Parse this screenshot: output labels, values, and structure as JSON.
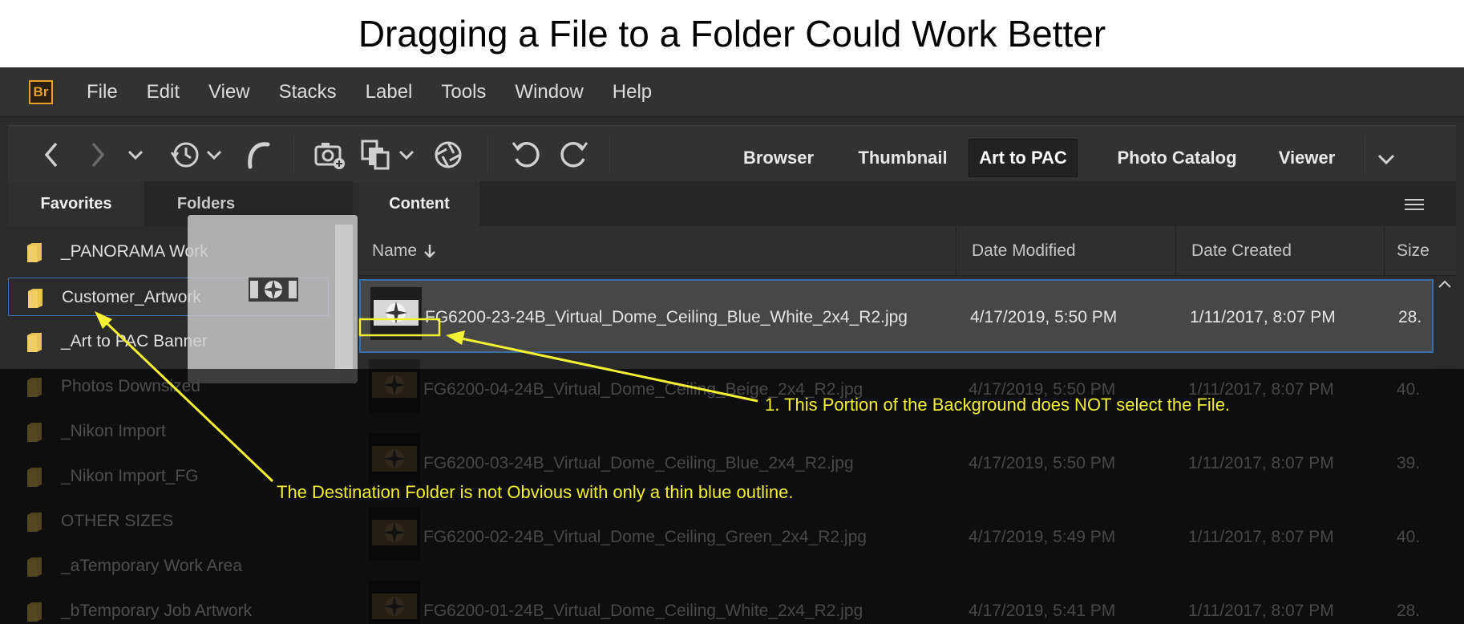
{
  "title": "Dragging a File to a Folder Could Work Better",
  "app": {
    "logo": "Br",
    "menu": [
      "File",
      "Edit",
      "View",
      "Stacks",
      "Label",
      "Tools",
      "Window",
      "Help"
    ],
    "toolbar_icons": [
      "back-icon",
      "forward-icon",
      "chevron-down-icon",
      "history-icon",
      "chevron-down-icon",
      "boomerang-icon",
      "camera-import-icon",
      "copy-files-icon",
      "chevron-down-icon",
      "aperture-icon",
      "rotate-left-icon",
      "rotate-right-icon"
    ],
    "workspaces": [
      "Browser",
      "Thumbnail",
      "Art to PAC",
      "Photo Catalog",
      "Viewer"
    ],
    "active_workspace": "Art to PAC"
  },
  "left_panel": {
    "tabs": [
      "Favorites",
      "Folders"
    ],
    "active_tab": "Favorites",
    "items": [
      {
        "label": "_PANORAMA Work"
      },
      {
        "label": "Customer_Artwork",
        "selected": true
      },
      {
        "label": "_Art to PAC Banner"
      },
      {
        "label": "Photos Downsized"
      },
      {
        "label": "_Nikon Import"
      },
      {
        "label": "_Nikon Import_FG"
      },
      {
        "label": "OTHER SIZES"
      },
      {
        "label": "_aTemporary Work Area"
      },
      {
        "label": "_bTemporary Job Artwork"
      }
    ]
  },
  "content_panel": {
    "tab": "Content",
    "columns": {
      "name": "Name",
      "modified": "Date Modified",
      "created": "Date Created",
      "size": "Size"
    },
    "sort_icon": "arrow-down-icon",
    "rows": [
      {
        "name": "FG6200-23-24B_Virtual_Dome_Ceiling_Blue_White_2x4_R2.jpg",
        "modified": "4/17/2019, 5:50 PM",
        "created": "1/11/2017, 8:07 PM",
        "size": "28.",
        "selected": true
      },
      {
        "name": "FG6200-04-24B_Virtual_Dome_Ceiling_Beige_2x4_R2.jpg",
        "modified": "4/17/2019, 5:50 PM",
        "created": "1/11/2017, 8:07 PM",
        "size": "40."
      },
      {
        "name": "FG6200-03-24B_Virtual_Dome_Ceiling_Blue_2x4_R2.jpg",
        "modified": "4/17/2019, 5:50 PM",
        "created": "1/11/2017, 8:07 PM",
        "size": "39."
      },
      {
        "name": "FG6200-02-24B_Virtual_Dome_Ceiling_Green_2x4_R2.jpg",
        "modified": "4/17/2019, 5:49 PM",
        "created": "1/11/2017, 8:07 PM",
        "size": "40."
      },
      {
        "name": "FG6200-01-24B_Virtual_Dome_Ceiling_White_2x4_R2.jpg",
        "modified": "4/17/2019, 5:41 PM",
        "created": "1/11/2017, 8:07 PM",
        "size": "28."
      }
    ]
  },
  "annotations": {
    "note1": "1. This Portion of the Background does NOT select the File.",
    "note2": "The Destination Folder is not Obvious with only a thin blue outline.",
    "color": "#f4f034"
  }
}
